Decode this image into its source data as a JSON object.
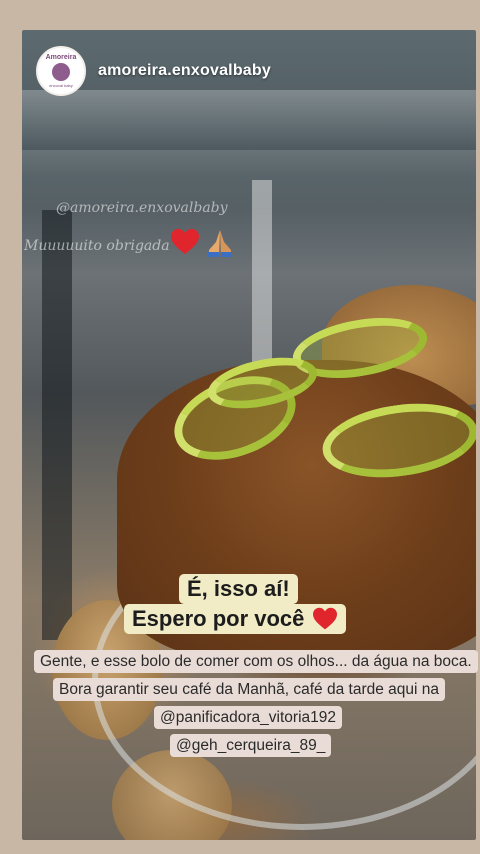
{
  "story": {
    "username": "amoreira.enxovalbaby",
    "avatar": {
      "mark": "Amoreira",
      "sub": "enxoval baby"
    },
    "watermark": {
      "handle": "@amoreira.enxovalbaby",
      "thanks": "Muuuuuito obrigada"
    },
    "sticker": {
      "line1": "É, isso aí!",
      "line2": "Espero por você"
    },
    "caption": {
      "line1": "Gente, e esse bolo de comer com os olhos... da água na boca.",
      "line2": "Bora garantir seu café da Manhã, café da tarde aqui na",
      "line3": "@panificadora_vitoria192",
      "line4": "@geh_cerqueira_89_"
    },
    "icons": [
      "heart-icon",
      "praying-hands-icon"
    ],
    "colors": {
      "heart": "#e0262c",
      "sticker_bg": "#f1ebc6",
      "caption_bg": "#e9dcd6",
      "frame_bg": "#c9b7a6"
    }
  }
}
